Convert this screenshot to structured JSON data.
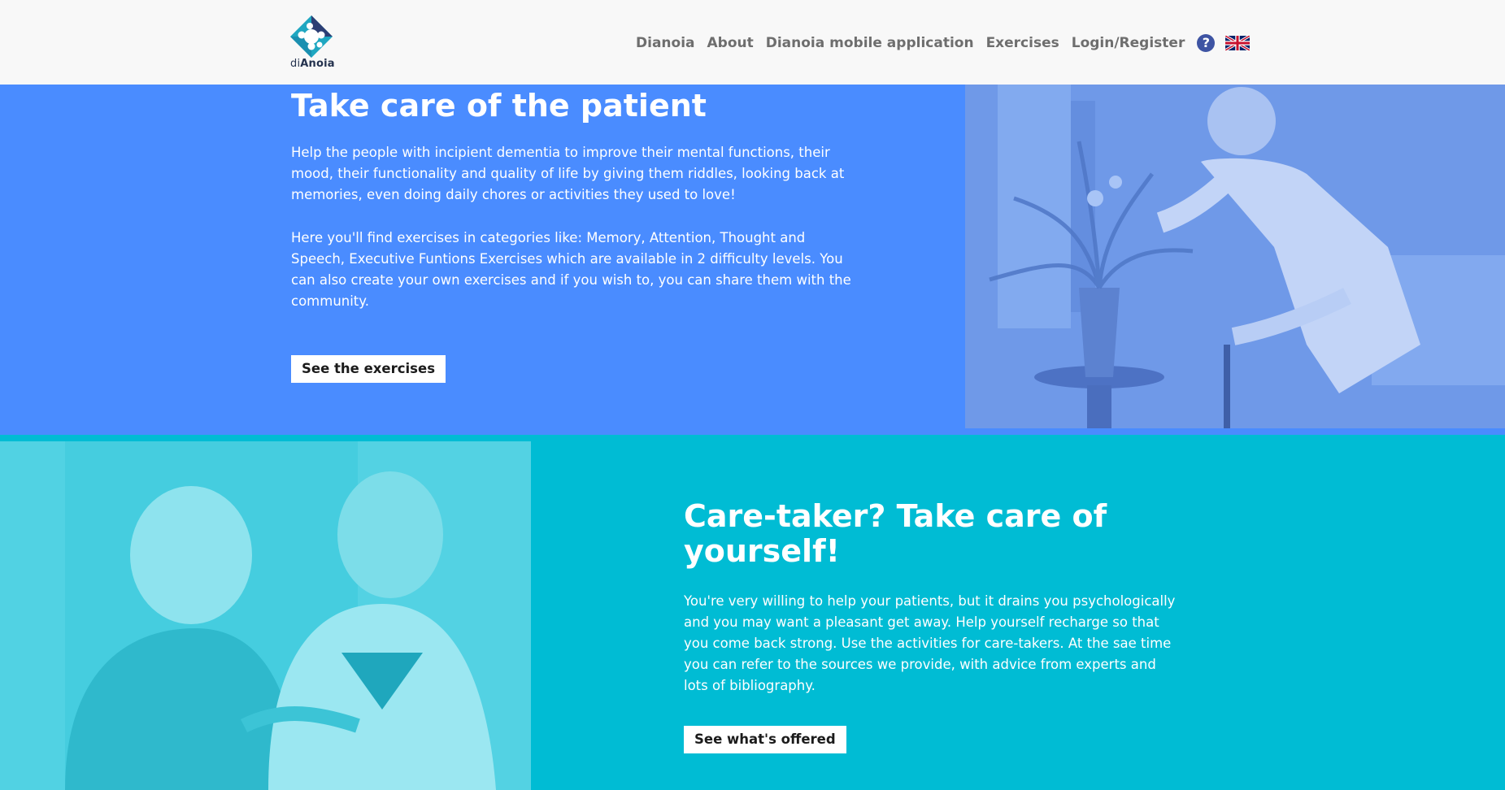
{
  "header": {
    "logo": {
      "text_prefix": "di",
      "text_bold": "Anoia",
      "icon": "dianoia-logo-icon"
    },
    "nav": [
      {
        "label": "Dianoia"
      },
      {
        "label": "About"
      },
      {
        "label": "Dianoia mobile application"
      },
      {
        "label": "Exercises"
      },
      {
        "label": "Login/Register"
      }
    ],
    "help_icon": "?",
    "language_icon": "uk-flag-icon"
  },
  "hero": {
    "title": "Take care of the patient",
    "paragraph_1": "Help the people with incipient dementia to improve their mental functions, their mood, their functionality and quality of life by giving them riddles, looking back at memories, even doing daily chores or activities they used to love!",
    "paragraph_2": "Here you'll find exercises in categories like: Memory, Attention, Thought and Speech, Executive Funtions Exercises which are available in 2 difficulty levels. You can also create your own exercises and if you wish to, you can share them with the community.",
    "button_label": "See the exercises",
    "photo_icon": "elderly-woman-flowers-photo",
    "background_color": "#4a8cff"
  },
  "caretaker": {
    "title": "Care-taker? Take care of yourself!",
    "paragraph": "You're very willing to help your patients, but it drains you psychologically and you may want a pleasant get away. Help yourself recharge so that you come back strong. Use the activities for care-takers. At the sae time you can refer to the sources we provide, with advice from experts and lots of bibliography.",
    "button_label": "See what's offered",
    "photo_icon": "caretaker-nurse-photo",
    "background_color": "#00bcd4"
  }
}
